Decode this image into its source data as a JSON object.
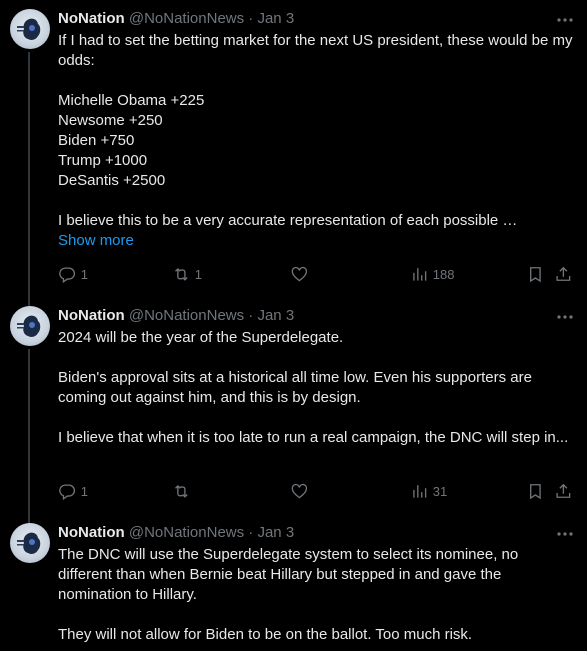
{
  "tweets": [
    {
      "name": "NoNation",
      "handle": "@NoNationNews",
      "date": "Jan 3",
      "text": "If I had to set the betting market for the next US president, these would be my odds:\n\nMichelle Obama +225\nNewsome +250\nBiden +750\nTrump +1000\nDeSantis +2500\n\nI believe this to be a very accurate representation of each possible …",
      "show_more": "Show more",
      "replies": "1",
      "reposts": "1",
      "likes": "",
      "views": "188"
    },
    {
      "name": "NoNation",
      "handle": "@NoNationNews",
      "date": "Jan 3",
      "text": "2024 will be the year of the Superdelegate.\n\nBiden's approval sits at a historical all time low. Even his supporters are coming out against him, and this is by design.\n\nI believe that when it is too late to run a real campaign, the DNC will step in...",
      "replies": "1",
      "reposts": "",
      "likes": "",
      "views": "31"
    },
    {
      "name": "NoNation",
      "handle": "@NoNationNews",
      "date": "Jan 3",
      "text": "The DNC will use the Superdelegate system to select its nominee, no different than when Bernie beat Hillary but stepped in and gave the nomination to Hillary.\n\nThey will not allow for Biden to be on the ballot. Too much risk."
    }
  ],
  "separator": " · ",
  "icons": {
    "more": "more-dots-icon",
    "reply": "reply-icon",
    "repost": "repost-icon",
    "like": "heart-icon",
    "views": "views-icon",
    "bookmark": "bookmark-icon",
    "share": "share-icon"
  },
  "colors": {
    "background": "#000000",
    "text": "#e7e9ea",
    "muted": "#71767b",
    "link": "#1d9bf0",
    "thread_line": "#333639"
  }
}
